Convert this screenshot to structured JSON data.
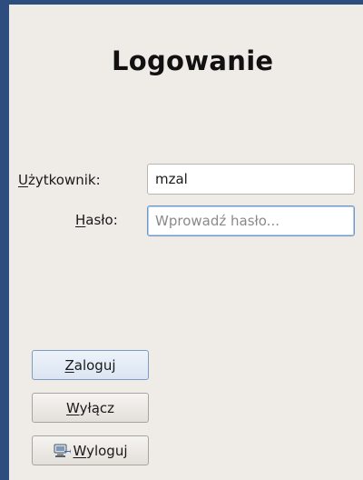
{
  "login": {
    "title": "Logowanie",
    "username_label_first": "U",
    "username_label_rest": "żytkownik:",
    "username_value": "mzal",
    "password_label_first": "H",
    "password_label_rest": "asło:",
    "password_placeholder": "Wprowadź hasło..."
  },
  "buttons": {
    "login_first": "Z",
    "login_rest": "aloguj",
    "shutdown_first": "W",
    "shutdown_rest": "yłącz",
    "logout_first": "W",
    "logout_rest": "yloguj",
    "logout_icon": "logout-icon"
  },
  "colors": {
    "frame": "#2c4d7e",
    "background": "#efebe7",
    "focus_border": "#6f98c8"
  }
}
